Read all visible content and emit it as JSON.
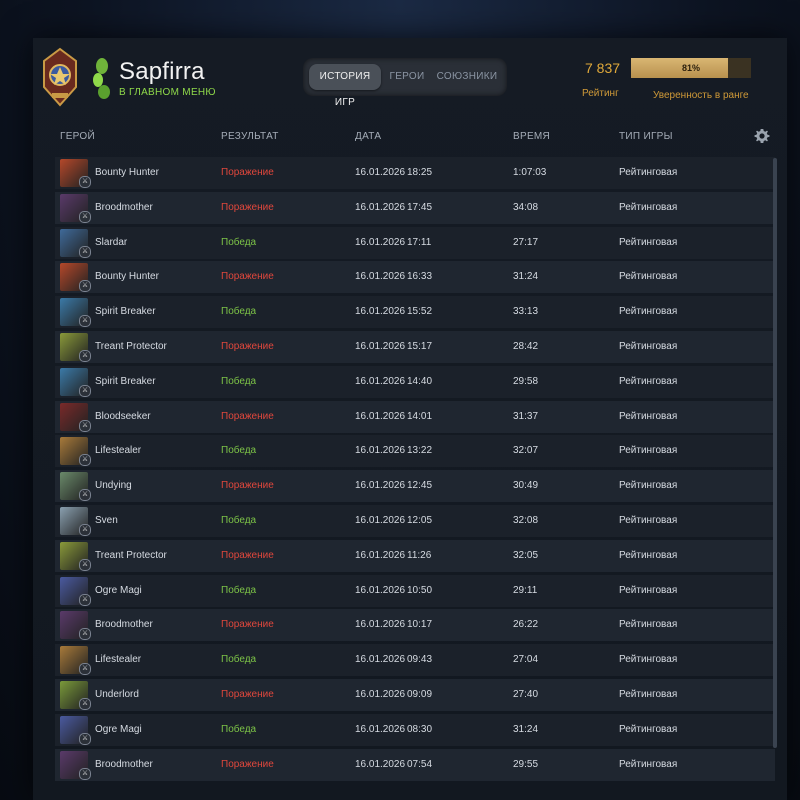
{
  "profile": {
    "username": "Sapfirra",
    "main_menu_link": "В ГЛАВНОМ МЕНЮ",
    "rating_value": "7 837",
    "rating_label": "Рейтинг",
    "confidence_percent": 81,
    "confidence_text": "81%",
    "confidence_label": "Уверенность в ранге"
  },
  "tabs": [
    {
      "label": "ИСТОРИЯ ИГР",
      "active": true
    },
    {
      "label": "ГЕРОИ",
      "active": false
    },
    {
      "label": "СОЮЗНИКИ",
      "active": false
    }
  ],
  "columns": {
    "hero": "ГЕРОЙ",
    "result": "РЕЗУЛЬТАТ",
    "date": "ДАТА",
    "duration": "ВРЕМЯ",
    "type": "ТИП ИГРЫ"
  },
  "matches": [
    {
      "hero": "Bounty Hunter",
      "result": "Поражение",
      "win": false,
      "date": "16.01.2026",
      "time": "18:25",
      "duration": "1:07:03",
      "type": "Рейтинговая"
    },
    {
      "hero": "Broodmother",
      "result": "Поражение",
      "win": false,
      "date": "16.01.2026",
      "time": "17:45",
      "duration": "34:08",
      "type": "Рейтинговая"
    },
    {
      "hero": "Slardar",
      "result": "Победа",
      "win": true,
      "date": "16.01.2026",
      "time": "17:11",
      "duration": "27:17",
      "type": "Рейтинговая"
    },
    {
      "hero": "Bounty Hunter",
      "result": "Поражение",
      "win": false,
      "date": "16.01.2026",
      "time": "16:33",
      "duration": "31:24",
      "type": "Рейтинговая"
    },
    {
      "hero": "Spirit Breaker",
      "result": "Победа",
      "win": true,
      "date": "16.01.2026",
      "time": "15:52",
      "duration": "33:13",
      "type": "Рейтинговая"
    },
    {
      "hero": "Treant Protector",
      "result": "Поражение",
      "win": false,
      "date": "16.01.2026",
      "time": "15:17",
      "duration": "28:42",
      "type": "Рейтинговая"
    },
    {
      "hero": "Spirit Breaker",
      "result": "Победа",
      "win": true,
      "date": "16.01.2026",
      "time": "14:40",
      "duration": "29:58",
      "type": "Рейтинговая"
    },
    {
      "hero": "Bloodseeker",
      "result": "Поражение",
      "win": false,
      "date": "16.01.2026",
      "time": "14:01",
      "duration": "31:37",
      "type": "Рейтинговая"
    },
    {
      "hero": "Lifestealer",
      "result": "Победа",
      "win": true,
      "date": "16.01.2026",
      "time": "13:22",
      "duration": "32:07",
      "type": "Рейтинговая"
    },
    {
      "hero": "Undying",
      "result": "Поражение",
      "win": false,
      "date": "16.01.2026",
      "time": "12:45",
      "duration": "30:49",
      "type": "Рейтинговая"
    },
    {
      "hero": "Sven",
      "result": "Победа",
      "win": true,
      "date": "16.01.2026",
      "time": "12:05",
      "duration": "32:08",
      "type": "Рейтинговая"
    },
    {
      "hero": "Treant Protector",
      "result": "Поражение",
      "win": false,
      "date": "16.01.2026",
      "time": "11:26",
      "duration": "32:05",
      "type": "Рейтинговая"
    },
    {
      "hero": "Ogre Magi",
      "result": "Победа",
      "win": true,
      "date": "16.01.2026",
      "time": "10:50",
      "duration": "29:11",
      "type": "Рейтинговая"
    },
    {
      "hero": "Broodmother",
      "result": "Поражение",
      "win": false,
      "date": "16.01.2026",
      "time": "10:17",
      "duration": "26:22",
      "type": "Рейтинговая"
    },
    {
      "hero": "Lifestealer",
      "result": "Победа",
      "win": true,
      "date": "16.01.2026",
      "time": "09:43",
      "duration": "27:04",
      "type": "Рейтинговая"
    },
    {
      "hero": "Underlord",
      "result": "Поражение",
      "win": false,
      "date": "16.01.2026",
      "time": "09:09",
      "duration": "27:40",
      "type": "Рейтинговая"
    },
    {
      "hero": "Ogre Magi",
      "result": "Победа",
      "win": true,
      "date": "16.01.2026",
      "time": "08:30",
      "duration": "31:24",
      "type": "Рейтинговая"
    },
    {
      "hero": "Broodmother",
      "result": "Поражение",
      "win": false,
      "date": "16.01.2026",
      "time": "07:54",
      "duration": "29:55",
      "type": "Рейтинговая"
    }
  ],
  "colors": {
    "win": "#7dc447",
    "loss": "#e0473c",
    "accent": "#e0a93a",
    "portraits": [
      "#b5482a",
      "#5a3a6a",
      "#3f6a9a",
      "#b5482a",
      "#3b7aa8",
      "#8a9a3a",
      "#3b7aa8",
      "#7a2a2a",
      "#a87a3a",
      "#6a8a6a",
      "#8aa0b0",
      "#8a9a3a",
      "#4a5aa0",
      "#5a3a6a",
      "#a87a3a",
      "#7a9a3a",
      "#4a5aa0",
      "#5a3a6a"
    ]
  },
  "icons": {
    "settings": "gear-icon",
    "rank": "rank-medal-icon",
    "avatar": "leaf-avatar-icon"
  }
}
